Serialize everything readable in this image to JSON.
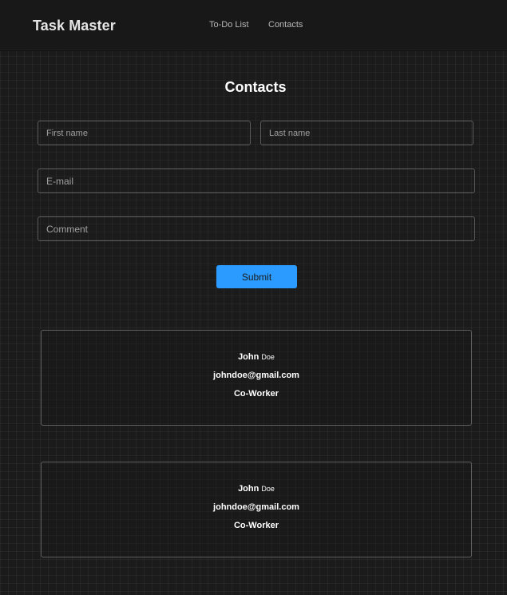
{
  "header": {
    "brand": "Task Master",
    "nav": [
      {
        "label": "To-Do List"
      },
      {
        "label": "Contacts"
      }
    ]
  },
  "page": {
    "title": "Contacts"
  },
  "form": {
    "first_name_placeholder": "First name",
    "last_name_placeholder": "Last name",
    "email_placeholder": "E-mail",
    "comment_placeholder": "Comment",
    "submit_label": "Submit"
  },
  "contacts": [
    {
      "first": "John",
      "last": "Doe",
      "email": "johndoe@gmail.com",
      "relation": "Co-Worker"
    },
    {
      "first": "John",
      "last": "Doe",
      "email": "johndoe@gmail.com",
      "relation": "Co-Worker"
    }
  ],
  "colors": {
    "accent": "#2b9bff",
    "background": "#1b1b1b",
    "navbar": "#181818"
  }
}
